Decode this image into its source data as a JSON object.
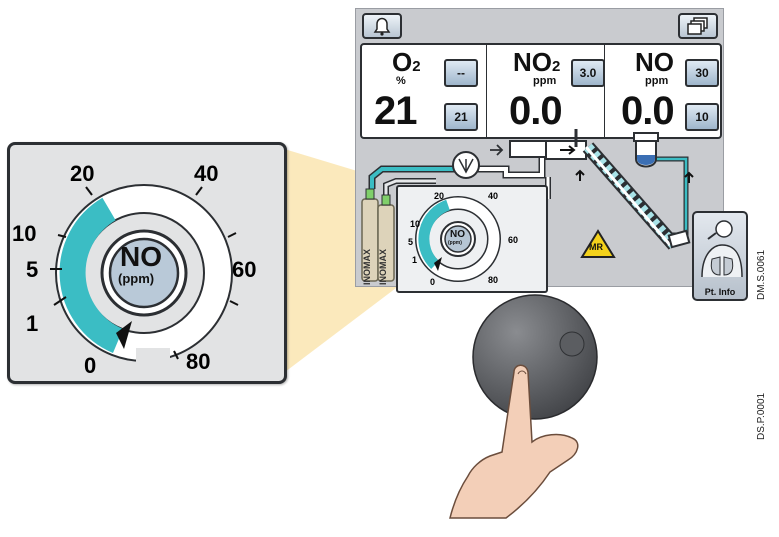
{
  "toolbar": {
    "alarm_icon": "bell-icon",
    "windows_icon": "windows-icon"
  },
  "readings": [
    {
      "gas": "O",
      "sub": "2",
      "unit": "%",
      "value": "21",
      "buttons": [
        "--",
        "21"
      ]
    },
    {
      "gas": "NO",
      "sub": "2",
      "unit": "ppm",
      "value": "0.0",
      "buttons": [
        "3.0"
      ]
    },
    {
      "gas": "NO",
      "sub": "",
      "unit": "ppm",
      "value": "0.0",
      "buttons": [
        "30",
        "10"
      ]
    }
  ],
  "dial": {
    "label_top": "NO",
    "label_bottom": "(ppm)",
    "ticks": [
      "0",
      "1",
      "5",
      "10",
      "20",
      "40",
      "60",
      "80"
    ],
    "setting_ppm": 0,
    "accent": "#3bbdc4"
  },
  "cylinders": [
    "INOMAX",
    "INOMAX"
  ],
  "mr_badge": "MR",
  "patient": {
    "label": "Pt. Info"
  },
  "codes": [
    "DM.S.0061",
    "DS.P.0001"
  ],
  "colors": {
    "screen": "#c9cbcf",
    "callout": "#fbe8b8",
    "tube": "#3bbdc4",
    "knob": "#5a5c60",
    "hand": "#f3cfb8"
  }
}
